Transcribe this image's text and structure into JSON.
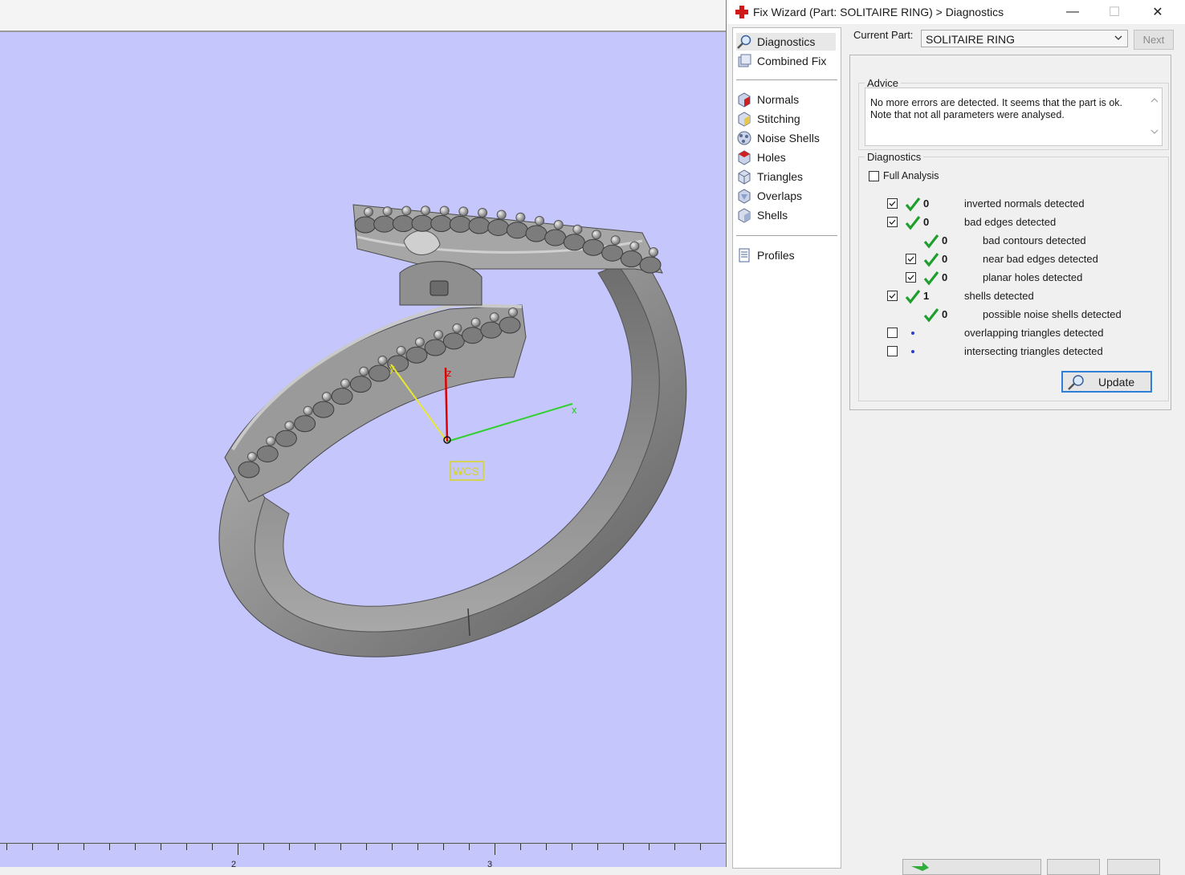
{
  "viewport": {
    "axis_labels": {
      "x": "x",
      "y": "y",
      "z": "z"
    },
    "wcs_label": "WCS",
    "ruler_labels": [
      "2",
      "3"
    ]
  },
  "dialog": {
    "title": "Fix Wizard (Part: SOLITAIRE RING) > Diagnostics",
    "window_buttons": {
      "minimize": "—",
      "maximize": "☐",
      "close": "✕"
    },
    "nav": {
      "top_items": [
        {
          "label": "Diagnostics",
          "icon": "magnifier-icon",
          "selected": true
        },
        {
          "label": "Combined Fix",
          "icon": "combined-fix-icon"
        }
      ],
      "fix_items": [
        {
          "label": "Normals",
          "icon": "normals-icon"
        },
        {
          "label": "Stitching",
          "icon": "stitching-icon"
        },
        {
          "label": "Noise Shells",
          "icon": "noise-shells-icon"
        },
        {
          "label": "Holes",
          "icon": "holes-icon"
        },
        {
          "label": "Triangles",
          "icon": "triangles-icon"
        },
        {
          "label": "Overlaps",
          "icon": "overlaps-icon"
        },
        {
          "label": "Shells",
          "icon": "shells-icon"
        }
      ],
      "bottom_items": [
        {
          "label": "Profiles",
          "icon": "profiles-icon"
        }
      ]
    },
    "current_part": {
      "label": "Current Part:",
      "value": "SOLITAIRE RING"
    },
    "next_label": "Next",
    "advice": {
      "title": "Advice",
      "lines": [
        "No more errors are detected. It seems that the part is ok.",
        "Note that not all parameters were analysed."
      ]
    },
    "diagnostics": {
      "title": "Diagnostics",
      "full_analysis": {
        "label": "Full Analysis",
        "checked": false
      },
      "rows": [
        {
          "checkbox": true,
          "checked": true,
          "status": "ok",
          "count": "0",
          "label": "inverted normals detected"
        },
        {
          "checkbox": true,
          "checked": true,
          "status": "ok",
          "count": "0",
          "label": "bad edges detected"
        },
        {
          "checkbox": false,
          "status": "ok",
          "count": "0",
          "label": "bad contours detected"
        },
        {
          "checkbox": true,
          "checked": true,
          "status": "ok",
          "count": "0",
          "label": "near bad edges detected"
        },
        {
          "checkbox": true,
          "checked": true,
          "status": "ok",
          "count": "0",
          "label": "planar holes detected"
        },
        {
          "checkbox": true,
          "checked": true,
          "status": "ok",
          "count": "1",
          "label": "shells detected"
        },
        {
          "checkbox": false,
          "status": "ok",
          "count": "0",
          "label": "possible noise shells detected"
        },
        {
          "checkbox": true,
          "checked": false,
          "status": "none",
          "count": "",
          "label": "overlapping triangles detected"
        },
        {
          "checkbox": true,
          "checked": false,
          "status": "none",
          "count": "",
          "label": "intersecting triangles detected"
        }
      ]
    },
    "update_label": "Update",
    "colors": {
      "check_green": "#1e9e2c",
      "accent_blue": "#2f7fd6",
      "viewport_bg": "#c5c6fb"
    }
  }
}
